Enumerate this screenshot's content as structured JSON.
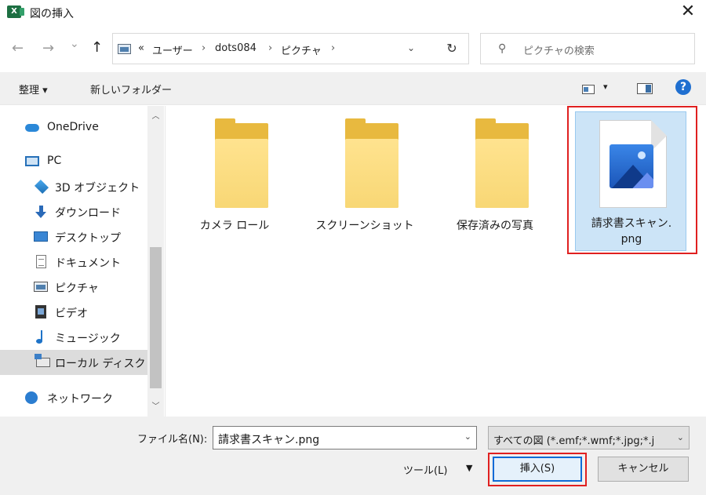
{
  "window": {
    "title": "図の挿入",
    "app_icon_letter": "X",
    "close_glyph": "✕"
  },
  "nav": {
    "back_glyph": "←",
    "forward_glyph": "→",
    "history_glyph": "⌄",
    "up_glyph": "↑",
    "breadcrumb_overflow": "«",
    "breadcrumbs": [
      "ユーザー",
      "dots084",
      "ピクチャ"
    ],
    "separator": "›",
    "dropdown_glyph": "⌄",
    "refresh_glyph": "↻",
    "search_placeholder": "ピクチャの検索",
    "search_glyph": "⚲"
  },
  "toolbar": {
    "organize_label": "整理 ▾",
    "new_folder_label": "新しいフォルダー",
    "view_dropdown_glyph": "▾",
    "help_glyph": "?"
  },
  "sidebar": {
    "items": [
      {
        "label": "OneDrive",
        "icon": "cloud-icon"
      },
      {
        "label": "PC",
        "icon": "pc-icon"
      },
      {
        "label": "3D オブジェクト",
        "icon": "cube-icon"
      },
      {
        "label": "ダウンロード",
        "icon": "download-icon"
      },
      {
        "label": "デスクトップ",
        "icon": "desktop-icon"
      },
      {
        "label": "ドキュメント",
        "icon": "document-icon"
      },
      {
        "label": "ピクチャ",
        "icon": "picture-icon"
      },
      {
        "label": "ビデオ",
        "icon": "video-icon"
      },
      {
        "label": "ミュージック",
        "icon": "music-icon"
      },
      {
        "label": "ローカル ディスク (C",
        "icon": "disk-icon"
      },
      {
        "label": "ネットワーク",
        "icon": "network-icon"
      }
    ],
    "scroll_up_glyph": "︿",
    "scroll_down_glyph": "﹀"
  },
  "content": {
    "folders": [
      {
        "label": "カメラ ロール"
      },
      {
        "label": "スクリーンショット"
      },
      {
        "label": "保存済みの写真"
      }
    ],
    "selected_file": {
      "label_line1": "請求書スキャン.",
      "label_line2": "png"
    }
  },
  "footer": {
    "filename_label": "ファイル名(N):",
    "filename_value": "請求書スキャン.png",
    "filetype_value": "すべての図 (*.emf;*.wmf;*.jpg;*.j",
    "tools_label": "ツール(L)",
    "tools_drop_glyph": "▼",
    "insert_label": "挿入(S)",
    "cancel_label": "キャンセル",
    "dropdown_glyph": "⌄"
  },
  "colors": {
    "highlight_red": "#e02020",
    "selection_blue": "#cce4f7",
    "primary_button_border": "#0f6bd6"
  }
}
